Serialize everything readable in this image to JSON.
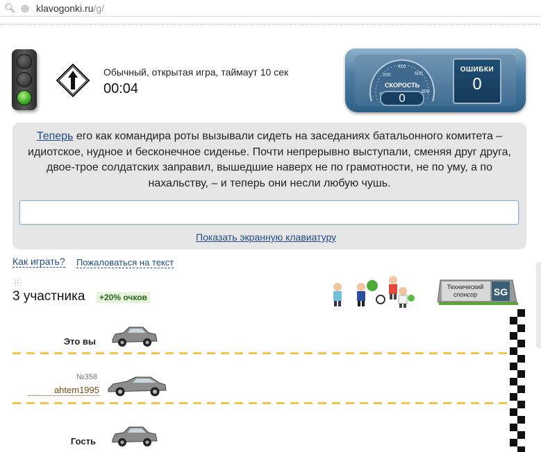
{
  "browser": {
    "url_domain": "klavogonki.ru",
    "url_path": "/g/"
  },
  "game": {
    "type_label": "Обычный, открытая игра, таймаут 10 сек",
    "timer": "00:04",
    "traffic_light_state": "green"
  },
  "dashboard": {
    "speed_label": "СКОРОСТЬ",
    "speed_value": "0",
    "errors_label": "ОШИБКИ",
    "errors_value": "0",
    "gauge_ticks": [
      "0",
      "200",
      "400",
      "600",
      "800"
    ]
  },
  "text_panel": {
    "current_word": "Теперь",
    "rest_text": " его как командира роты вызывали сидеть на заседаниях батальонного комитета – идиотское, нудное и бесконечное сиденье. Почти непрерывно выступали, сменяя друг друга, двое-трое солдатских заправил, вышедшие наверх не по грамотности, не по уму, а по нахальству, – и теперь они несли любую чушь.",
    "input_value": "",
    "show_keyboard_link": "Показать экранную клавиатуру"
  },
  "links": {
    "how_to_play": "Как играть?",
    "report_text": "Пожаловаться на текст"
  },
  "race": {
    "participants_label": "3 участника",
    "bonus_label": "+20% очков",
    "sponsor_line1": "Технический",
    "sponsor_line2": "спонсор",
    "sponsor_logo": "SG",
    "racers": [
      {
        "name": "Это вы"
      },
      {
        "rank": "№358",
        "nick": "ahtem1995"
      },
      {
        "name": "Гость"
      }
    ]
  },
  "colors": {
    "link": "#1f4a8a",
    "panel_bg": "#e6e6e6",
    "track_line": "#f2c44a",
    "dashboard": "#4d7ea3"
  }
}
